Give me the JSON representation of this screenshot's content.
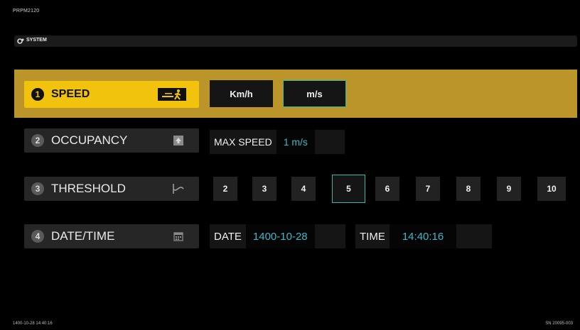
{
  "device": {
    "model": "PRPM2120"
  },
  "system_bar": {
    "label": "SYSTEM",
    "icon": "gear-icon"
  },
  "menu": [
    {
      "num": "1",
      "label": "SPEED",
      "icon": "pedestrian-speed-icon",
      "active": true
    },
    {
      "num": "2",
      "label": "OCCUPANCY",
      "icon": "occupancy-icon",
      "active": false
    },
    {
      "num": "3",
      "label": "THRESHOLD",
      "icon": "threshold-icon",
      "active": false
    },
    {
      "num": "4",
      "label": "DATE/TIME",
      "icon": "calendar-icon",
      "active": false
    }
  ],
  "speed_units": {
    "kmh": "Km/h",
    "ms": "m/s",
    "selected": "m/s"
  },
  "occupancy": {
    "label": "MAX SPEED",
    "value": "1 m/s"
  },
  "threshold": {
    "options": [
      "2",
      "3",
      "4",
      "5",
      "6",
      "7",
      "8",
      "9",
      "10"
    ],
    "selected": "5"
  },
  "datetime": {
    "date_label": "DATE",
    "date_value": "1400-10-28",
    "time_label": "TIME",
    "time_value": "14:40:16"
  },
  "footer": {
    "timestamp": "1400-10-28 14:40:16",
    "serial": "SN 20095-003"
  },
  "colors": {
    "accent_yellow": "#f2c30d",
    "highlight_band": "#bb952a",
    "selection_teal": "#2fb8a6",
    "value_text": "#3fb7c8"
  }
}
